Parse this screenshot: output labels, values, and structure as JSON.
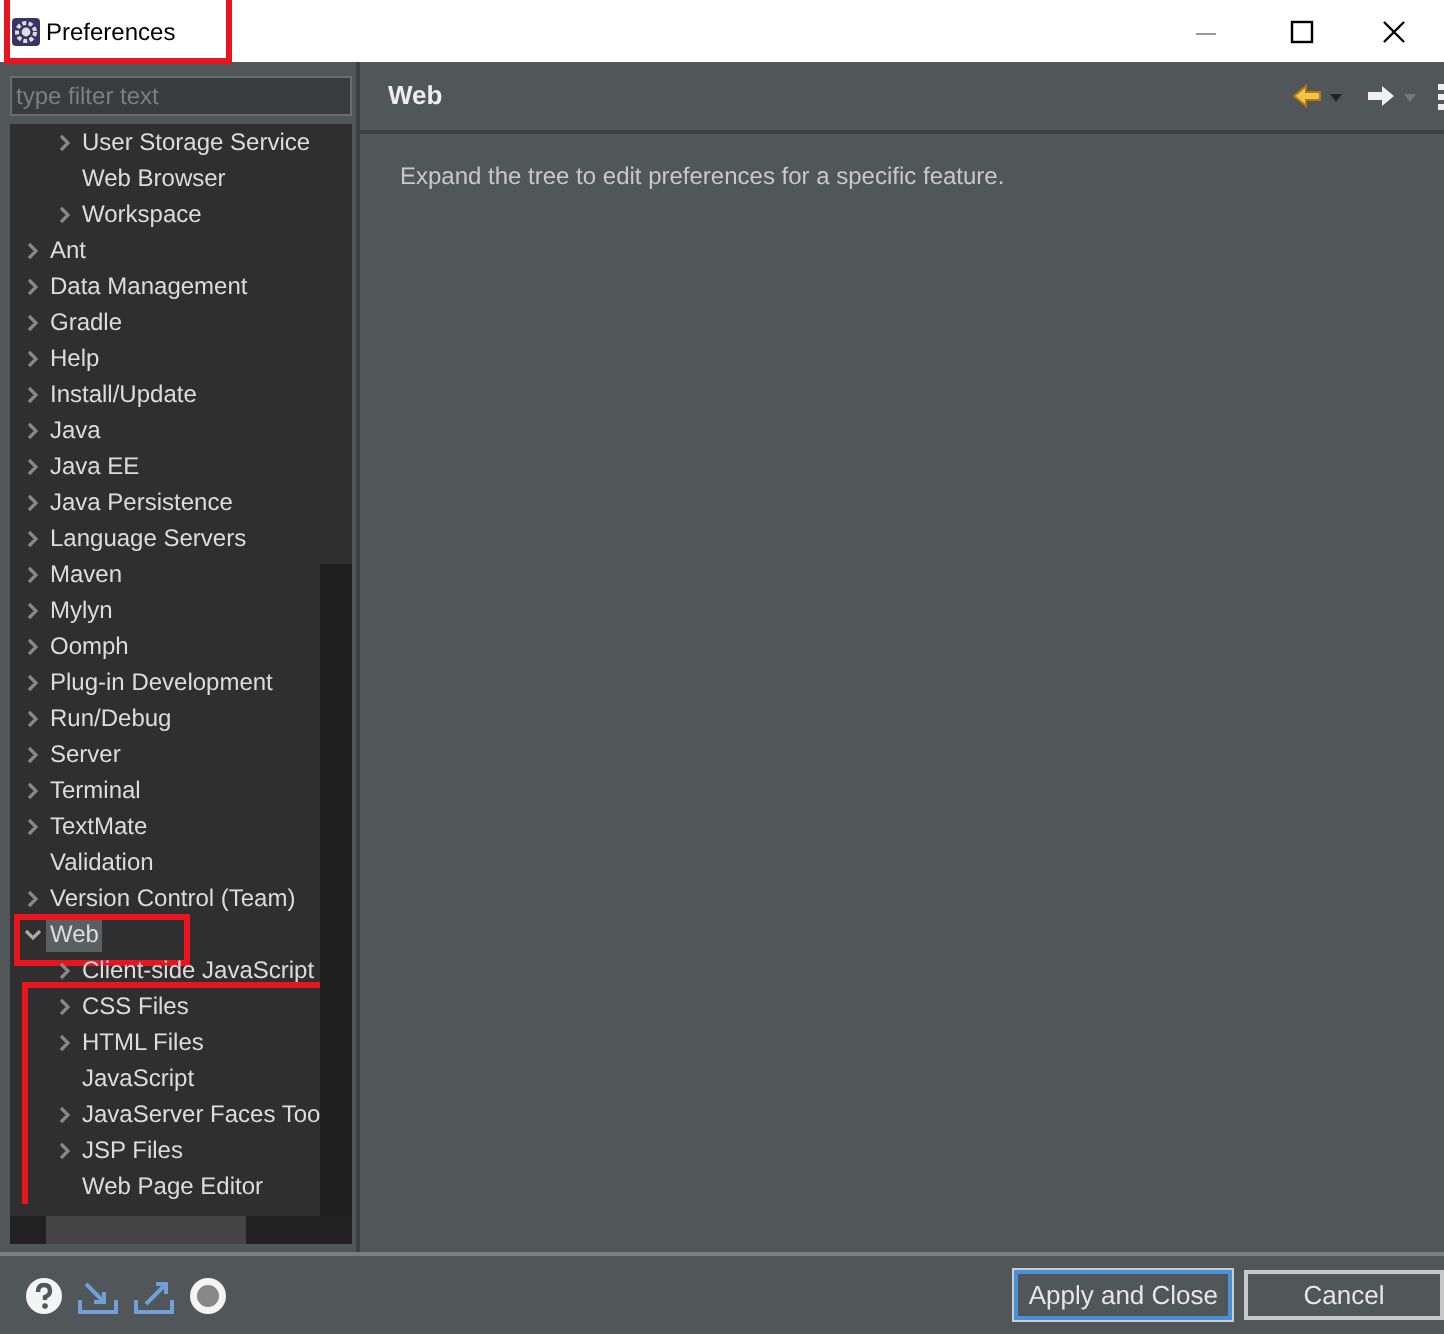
{
  "window": {
    "title": "Preferences",
    "highlighted": true
  },
  "filter": {
    "placeholder": "type filter text"
  },
  "tree_continued": [
    {
      "label": "User Storage Service",
      "expandable": true
    },
    {
      "label": "Web Browser",
      "expandable": false
    },
    {
      "label": "Workspace",
      "expandable": true
    }
  ],
  "tree": [
    {
      "label": "Ant",
      "expandable": true,
      "expanded": false,
      "selected": false
    },
    {
      "label": "Data Management",
      "expandable": true,
      "expanded": false,
      "selected": false
    },
    {
      "label": "Gradle",
      "expandable": true,
      "expanded": false,
      "selected": false
    },
    {
      "label": "Help",
      "expandable": true,
      "expanded": false,
      "selected": false
    },
    {
      "label": "Install/Update",
      "expandable": true,
      "expanded": false,
      "selected": false
    },
    {
      "label": "Java",
      "expandable": true,
      "expanded": false,
      "selected": false
    },
    {
      "label": "Java EE",
      "expandable": true,
      "expanded": false,
      "selected": false
    },
    {
      "label": "Java Persistence",
      "expandable": true,
      "expanded": false,
      "selected": false
    },
    {
      "label": "Language Servers",
      "expandable": true,
      "expanded": false,
      "selected": false
    },
    {
      "label": "Maven",
      "expandable": true,
      "expanded": false,
      "selected": false
    },
    {
      "label": "Mylyn",
      "expandable": true,
      "expanded": false,
      "selected": false
    },
    {
      "label": "Oomph",
      "expandable": true,
      "expanded": false,
      "selected": false
    },
    {
      "label": "Plug-in Development",
      "expandable": true,
      "expanded": false,
      "selected": false
    },
    {
      "label": "Run/Debug",
      "expandable": true,
      "expanded": false,
      "selected": false
    },
    {
      "label": "Server",
      "expandable": true,
      "expanded": false,
      "selected": false
    },
    {
      "label": "Terminal",
      "expandable": true,
      "expanded": false,
      "selected": false
    },
    {
      "label": "TextMate",
      "expandable": true,
      "expanded": false,
      "selected": false
    },
    {
      "label": "Validation",
      "expandable": false,
      "selected": false
    },
    {
      "label": "Version Control (Team)",
      "expandable": true,
      "expanded": false,
      "selected": false
    },
    {
      "label": "Web",
      "expandable": true,
      "expanded": true,
      "selected": true,
      "highlighted": true,
      "children_highlighted": true,
      "children": [
        {
          "label": "Client-side JavaScript",
          "expandable": true
        },
        {
          "label": "CSS Files",
          "expandable": true
        },
        {
          "label": "HTML Files",
          "expandable": true
        },
        {
          "label": "JavaScript",
          "expandable": false
        },
        {
          "label": "JavaServer Faces Too",
          "expandable": true
        },
        {
          "label": "JSP Files",
          "expandable": true
        },
        {
          "label": "Web Page Editor",
          "expandable": false
        }
      ]
    }
  ],
  "page": {
    "title": "Web",
    "description": "Expand the tree to edit preferences for a specific feature."
  },
  "buttons": [
    {
      "label": "Apply and Close",
      "default": true
    },
    {
      "label": "Cancel",
      "default": false
    }
  ]
}
